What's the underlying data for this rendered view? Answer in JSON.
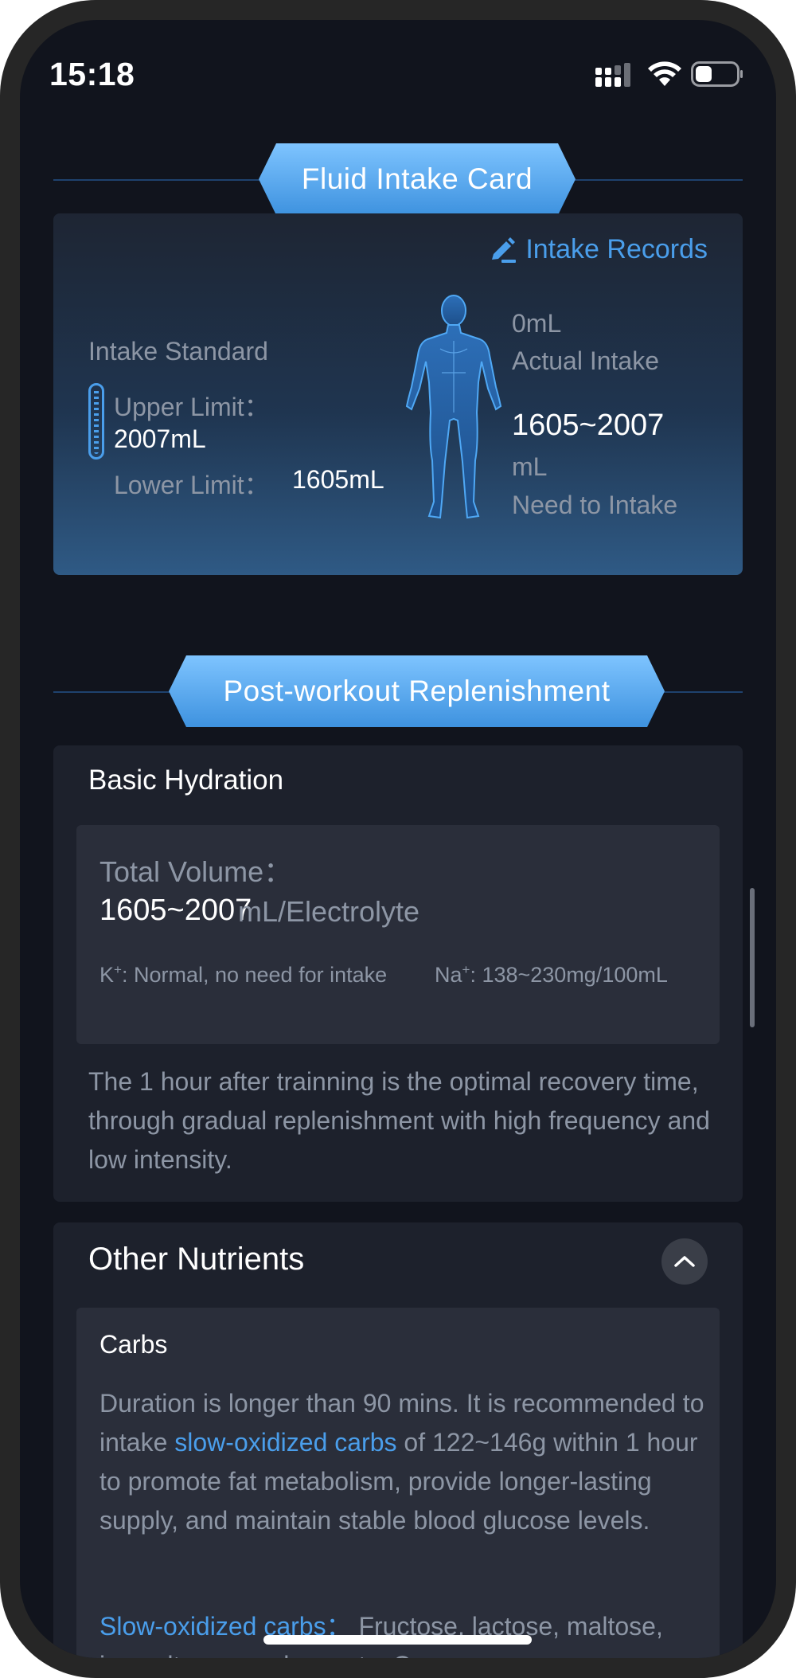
{
  "status_bar": {
    "time": "15:18"
  },
  "intake_section": {
    "header": "Fluid Intake Card",
    "records_link": "Intake Records",
    "standard_label": "Intake Standard",
    "upper_limit_label": "Upper Limit：",
    "upper_limit_value": "2007mL",
    "lower_limit_label": "Lower Limit：",
    "lower_limit_value": "1605mL",
    "actual_value": "0mL",
    "actual_label": "Actual Intake",
    "need_value": "1605~2007",
    "need_unit": "mL",
    "need_label": "Need to Intake"
  },
  "replenishment_section": {
    "header": "Post-workout Replenishment",
    "basic_hydration": {
      "title": "Basic Hydration",
      "total_label": "Total Volume：",
      "total_value": "1605~2007",
      "total_unit": "mL/Electrolyte",
      "k_symbol": "K",
      "k_sup": "+",
      "k_text": ": Normal, no need for intake",
      "na_symbol": "Na",
      "na_sup": "+",
      "na_text": ": 138~230mg/100mL",
      "description": "The 1 hour after trainning is the optimal recovery time, through gradual replenishment with high frequency and low intensity."
    },
    "other_nutrients": {
      "title": "Other Nutrients",
      "carbs_title": "Carbs",
      "carbs_desc_1": "Duration is longer than 90 mins. It is recommended to intake ",
      "carbs_desc_link": "slow-oxidized carbs",
      "carbs_desc_2": " of 122~146g within 1 hour to promote fat metabolism, provide longer-lasting supply, and maintain stable blood glucose levels.",
      "slow_carbs_label": "Slow-oxidized carbs：",
      "slow_carbs_text": " Fructose, lactose, maltose, isomaltose, amylose, etc. Common"
    }
  },
  "icons": {
    "edit": "edit-pencil-icon",
    "gauge": "gauge-icon",
    "body": "human-body-icon",
    "collapse": "chevron-up-icon"
  },
  "colors": {
    "background": "#11141d",
    "card": "#1d212c",
    "accent": "#4a9eeb",
    "muted_text": "#8d96a5"
  }
}
